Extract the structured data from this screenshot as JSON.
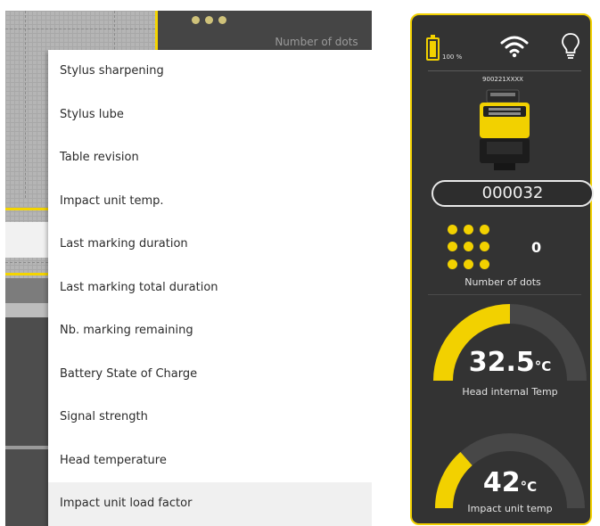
{
  "left_screen": {
    "top_widget": {
      "label": "Number of dots"
    },
    "menu": {
      "items": [
        "Stylus sharpening",
        "Stylus lube",
        "Table revision",
        "Impact unit temp.",
        "Last marking duration",
        "Last marking total duration",
        "Nb. marking remaining",
        "Battery State of Charge",
        "Signal strength",
        "Head temperature",
        "Impact unit load factor"
      ],
      "highlighted_index": 10
    }
  },
  "device_panel": {
    "status": {
      "battery_percent": "100 %",
      "battery_level": 1.0,
      "wifi_icon": "wifi-icon",
      "light_icon": "lightbulb-icon"
    },
    "serial": "900221XXXX",
    "counter": "000032",
    "dots": {
      "count": "0",
      "label": "Number of dots"
    },
    "head_temp": {
      "value": "32.5",
      "unit": "°C",
      "label": "Head internal Temp",
      "fill_fraction": 0.5
    },
    "impact_temp": {
      "value": "42",
      "unit": "°C",
      "label": "Impact unit temp",
      "fill_fraction": 0.27
    },
    "colors": {
      "accent": "#f2d100",
      "panel_bg": "#333333",
      "gauge_track": "#474747"
    }
  }
}
